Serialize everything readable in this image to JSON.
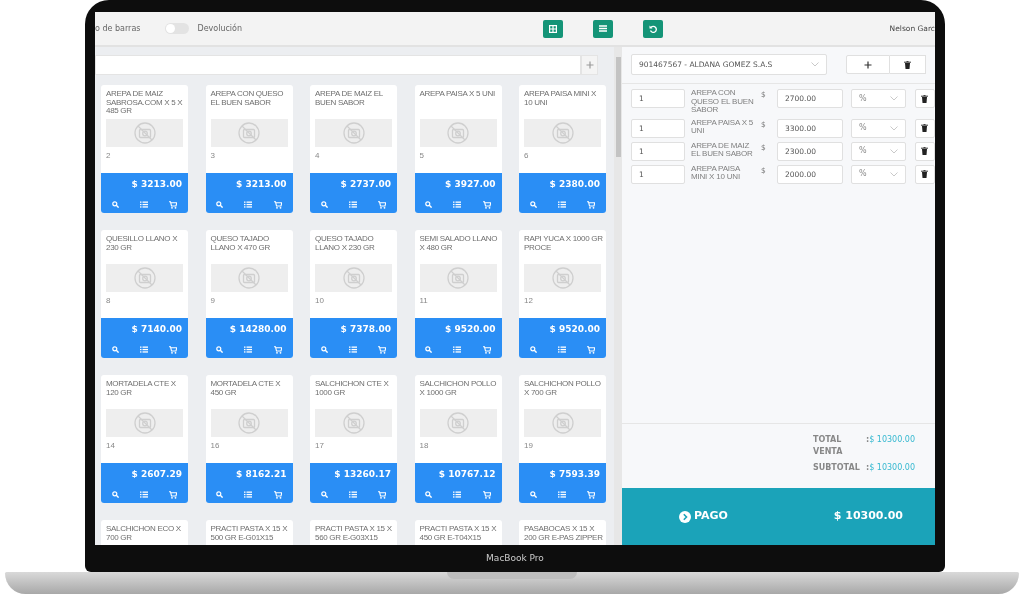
{
  "device": {
    "label": "MacBook Pro"
  },
  "toolbar": {
    "barcode_label": "o de barras",
    "return_toggle": {
      "label": "Devolución",
      "on": false
    },
    "buttons": [
      {
        "kind": "grid"
      },
      {
        "kind": "list"
      },
      {
        "kind": "undo"
      }
    ],
    "user": "Nelson Garc"
  },
  "products": [
    {
      "name": "AREPA DE MAIZ SABROSA.COM X 5 X 485 GR",
      "number": "2",
      "price": "$ 3213.00"
    },
    {
      "name": "AREPA CON QUESO EL BUEN SABOR",
      "number": "3",
      "price": "$ 3213.00"
    },
    {
      "name": "AREPA DE MAIZ EL BUEN SABOR",
      "number": "4",
      "price": "$ 2737.00"
    },
    {
      "name": "AREPA PAISA X 5 UNI",
      "number": "5",
      "price": "$ 3927.00"
    },
    {
      "name": "AREPA PAISA MINI X 10 UNI",
      "number": "6",
      "price": "$ 2380.00"
    },
    {
      "name": "QUESILLO LLANO X 230 GR",
      "number": "8",
      "price": "$ 7140.00"
    },
    {
      "name": "QUESO TAJADO LLANO X 470 GR",
      "number": "9",
      "price": "$ 14280.00"
    },
    {
      "name": "QUESO TAJADO LLANO X 230 GR",
      "number": "10",
      "price": "$ 7378.00"
    },
    {
      "name": "SEMI SALADO LLANO X 480 GR",
      "number": "11",
      "price": "$ 9520.00"
    },
    {
      "name": "RAPI YUCA X 1000 GR PROCE",
      "number": "12",
      "price": "$ 9520.00"
    },
    {
      "name": "MORTADELA CTE X 120 GR",
      "number": "14",
      "price": "$ 2607.29"
    },
    {
      "name": "MORTADELA CTE X 450 GR",
      "number": "16",
      "price": "$ 8162.21"
    },
    {
      "name": "SALCHICHON CTE X 1000 GR",
      "number": "17",
      "price": "$ 13260.17"
    },
    {
      "name": "SALCHICHON POLLO X 1000 GR",
      "number": "18",
      "price": "$ 10767.12"
    },
    {
      "name": "SALCHICHON POLLO X 700 GR",
      "number": "19",
      "price": "$ 7593.39"
    },
    {
      "name": "SALCHICHON ECO X 700 GR"
    },
    {
      "name": "PRACTI PASTA X 15 X 500 GR E-G01X15"
    },
    {
      "name": "PRACTI PASTA X 15 X 560 GR E-G03X15"
    },
    {
      "name": "PRACTI PASTA X 15 X 450 GR E-T04X15"
    },
    {
      "name": "PASABOCAS X 15 X 200 GR E-PAS ZIPPER"
    }
  ],
  "customer": {
    "value": "901467567 - ALDANA GOMEZ S.A.S"
  },
  "cart_items": [
    {
      "quantity": "1",
      "name": "AREPA CON QUESO EL BUEN SABOR",
      "currency": "$",
      "price": "2700.00",
      "discount_placeholder": "%"
    },
    {
      "quantity": "1",
      "name": "AREPA PAISA X 5 UNI",
      "currency": "$",
      "price": "3300.00",
      "discount_placeholder": "%"
    },
    {
      "quantity": "1",
      "name": "AREPA DE MAIZ EL BUEN SABOR",
      "currency": "$",
      "price": "2300.00",
      "discount_placeholder": "%"
    },
    {
      "quantity": "1",
      "name": "AREPA PAISA MINI X 10 UNI",
      "currency": "$",
      "price": "2000.00",
      "discount_placeholder": "%"
    }
  ],
  "totals": [
    {
      "label": "TOTAL VENTA",
      "separator": ":",
      "value": "$ 10300.00"
    },
    {
      "label": "SUBTOTAL",
      "separator": ":",
      "value": "$ 10300.00"
    }
  ],
  "payment": {
    "label": "PAGO",
    "amount": "$ 10300.00"
  }
}
